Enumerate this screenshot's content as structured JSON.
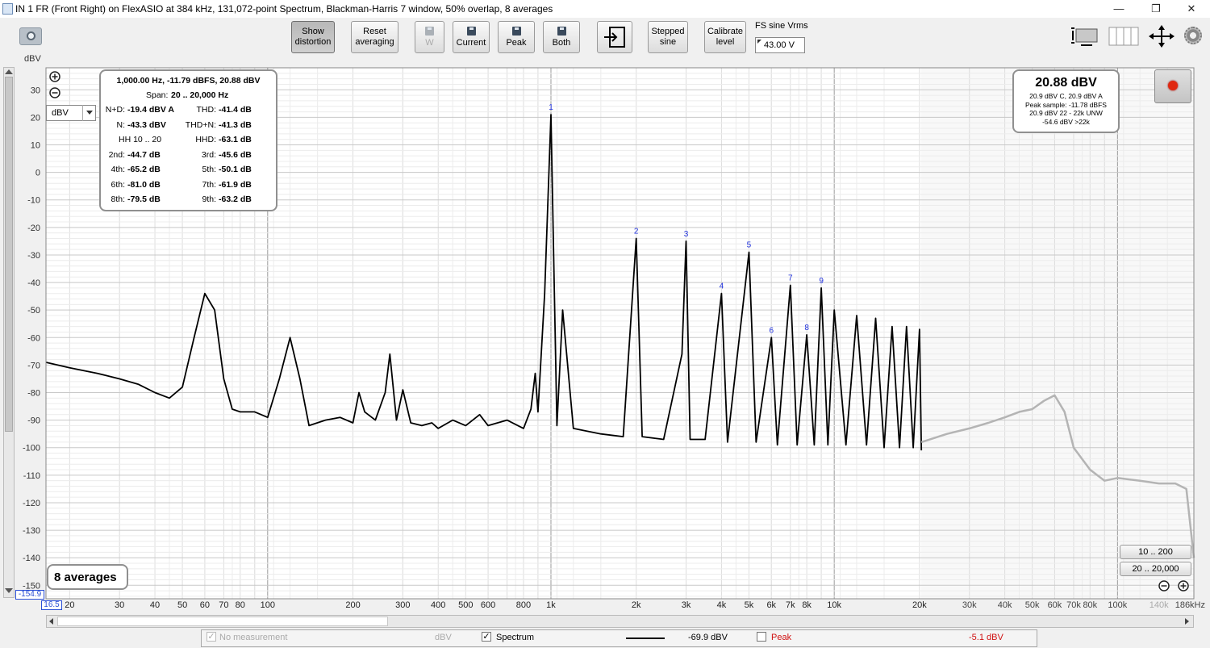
{
  "window": {
    "title": "IN 1 FR (Front Right) on FlexASIO at 384 kHz, 131,072-point Spectrum, Blackman-Harris 7 window, 50% overlap, 8 averages",
    "minimize": "—",
    "restore": "❐",
    "close": "✕"
  },
  "toolbar": {
    "show_distortion": [
      "Show",
      "distortion"
    ],
    "reset_averaging": [
      "Reset",
      "averaging"
    ],
    "w": "W",
    "current": "Current",
    "peak": "Peak",
    "both": "Both",
    "stepped_sine": [
      "Stepped",
      "sine"
    ],
    "calibrate_level": [
      "Calibrate",
      "level"
    ],
    "fs_label": "FS sine Vrms",
    "fs_value": "43.00 V"
  },
  "plot": {
    "y_unit": "dBV",
    "unit_select": "dBV",
    "y_bottom_readout": "-154.9",
    "x_left_readout": "16.5",
    "averages_label": "8 averages",
    "range_buttons": [
      "10 .. 200",
      "20 .. 20,000"
    ]
  },
  "distortion": {
    "header": "1,000.00 Hz, -11.79 dBFS, 20.88 dBV",
    "span_label": "Span:",
    "span_value": "20 .. 20,000 Hz",
    "rows": [
      {
        "l": "N+D:",
        "lv": "-19.4 dBV A",
        "r": "THD:",
        "rv": "-41.4 dB"
      },
      {
        "l": "N:",
        "lv": "-43.3 dBV",
        "r": "THD+N:",
        "rv": "-41.3 dB"
      },
      {
        "l": "HH 10 .. 20",
        "lv": "",
        "r": "HHD:",
        "rv": "-63.1 dB"
      },
      {
        "l": "2nd:",
        "lv": "-44.7 dB",
        "r": "3rd:",
        "rv": "-45.6 dB"
      },
      {
        "l": "4th:",
        "lv": "-65.2 dB",
        "r": "5th:",
        "rv": "-50.1 dB"
      },
      {
        "l": "6th:",
        "lv": "-81.0 dB",
        "r": "7th:",
        "rv": "-61.9 dB"
      },
      {
        "l": "8th:",
        "lv": "-79.5 dB",
        "r": "9th:",
        "rv": "-63.2 dB"
      }
    ]
  },
  "level": {
    "main": "20.88 dBV",
    "lines": [
      "20.9 dBV C, 20.9 dBV A",
      "Peak sample: -11.78 dBFS",
      "20.9 dBV 22 - 22k UNW",
      "-54.6 dBV >22k"
    ]
  },
  "legend": {
    "no_measurement": "No measurement",
    "no_measurement_unit": "dBV",
    "spectrum": "Spectrum",
    "spectrum_value": "-69.9 dBV",
    "peak": "Peak",
    "peak_value": "-5.1 dBV",
    "check": "✓"
  },
  "chart_data": {
    "type": "line",
    "xlabel": "",
    "ylabel": "dBV",
    "x_scale": "log",
    "xlim": [
      16.5,
      186000
    ],
    "ylim": [
      -154.9,
      38
    ],
    "x_tick_labels": [
      "20",
      "30",
      "40",
      "50",
      "60",
      "70",
      "80",
      "100",
      "200",
      "300",
      "400",
      "500",
      "600",
      "800",
      "1k",
      "2k",
      "3k",
      "4k",
      "5k",
      "6k",
      "7k",
      "8k",
      "10k",
      "20k",
      "30k",
      "40k",
      "50k",
      "60k",
      "70k",
      "80k",
      "100k",
      "140k",
      "186kHz"
    ],
    "x_tick_values": [
      20,
      30,
      40,
      50,
      60,
      70,
      80,
      100,
      200,
      300,
      400,
      500,
      600,
      800,
      1000,
      2000,
      3000,
      4000,
      5000,
      6000,
      7000,
      8000,
      10000,
      20000,
      30000,
      40000,
      50000,
      60000,
      70000,
      80000,
      100000,
      140000,
      186000
    ],
    "y_ticks": [
      30,
      20,
      10,
      0,
      -10,
      -20,
      -30,
      -40,
      -50,
      -60,
      -70,
      -80,
      -90,
      -100,
      -110,
      -120,
      -130,
      -140,
      -150
    ],
    "harmonic_markers": [
      {
        "label": "1",
        "x": 1000,
        "y": 21
      },
      {
        "label": "2",
        "x": 2000,
        "y": -24
      },
      {
        "label": "3",
        "x": 3000,
        "y": -25
      },
      {
        "label": "4",
        "x": 4000,
        "y": -44
      },
      {
        "label": "5",
        "x": 5000,
        "y": -29
      },
      {
        "label": "6",
        "x": 6000,
        "y": -60
      },
      {
        "label": "7",
        "x": 7000,
        "y": -41
      },
      {
        "label": "8",
        "x": 8000,
        "y": -59
      },
      {
        "label": "9",
        "x": 9000,
        "y": -42
      }
    ],
    "series": [
      {
        "color": "#000000",
        "points": [
          [
            16.5,
            -69
          ],
          [
            20,
            -71
          ],
          [
            25,
            -73
          ],
          [
            30,
            -75
          ],
          [
            35,
            -77
          ],
          [
            40,
            -80
          ],
          [
            45,
            -82
          ],
          [
            50,
            -78
          ],
          [
            55,
            -60
          ],
          [
            60,
            -44
          ],
          [
            65,
            -50
          ],
          [
            70,
            -75
          ],
          [
            75,
            -86
          ],
          [
            80,
            -87
          ],
          [
            90,
            -87
          ],
          [
            100,
            -89
          ],
          [
            110,
            -75
          ],
          [
            120,
            -60
          ],
          [
            130,
            -75
          ],
          [
            140,
            -92
          ],
          [
            160,
            -90
          ],
          [
            180,
            -89
          ],
          [
            200,
            -91
          ],
          [
            210,
            -80
          ],
          [
            220,
            -87
          ],
          [
            240,
            -90
          ],
          [
            260,
            -80
          ],
          [
            270,
            -66
          ],
          [
            285,
            -90
          ],
          [
            300,
            -79
          ],
          [
            320,
            -91
          ],
          [
            350,
            -92
          ],
          [
            380,
            -91
          ],
          [
            400,
            -93
          ],
          [
            450,
            -90
          ],
          [
            500,
            -92
          ],
          [
            560,
            -88
          ],
          [
            600,
            -92
          ],
          [
            700,
            -90
          ],
          [
            800,
            -93
          ],
          [
            850,
            -86
          ],
          [
            880,
            -73
          ],
          [
            900,
            -87
          ],
          [
            950,
            -44
          ],
          [
            1000,
            21
          ],
          [
            1050,
            -92
          ],
          [
            1100,
            -50
          ],
          [
            1200,
            -93
          ],
          [
            1500,
            -95
          ],
          [
            1800,
            -96
          ],
          [
            2000,
            -24
          ],
          [
            2100,
            -96
          ],
          [
            2500,
            -97
          ],
          [
            2900,
            -66
          ],
          [
            3000,
            -25
          ],
          [
            3100,
            -97
          ],
          [
            3500,
            -97
          ],
          [
            4000,
            -44
          ],
          [
            4200,
            -98
          ],
          [
            5000,
            -29
          ],
          [
            5300,
            -98
          ],
          [
            6000,
            -60
          ],
          [
            6300,
            -99
          ],
          [
            7000,
            -41
          ],
          [
            7400,
            -99
          ],
          [
            8000,
            -59
          ],
          [
            8500,
            -99
          ],
          [
            9000,
            -42
          ],
          [
            9500,
            -99
          ],
          [
            10000,
            -50
          ],
          [
            11000,
            -99
          ],
          [
            12000,
            -52
          ],
          [
            13000,
            -99
          ],
          [
            14000,
            -53
          ],
          [
            15000,
            -100
          ],
          [
            16000,
            -56
          ],
          [
            17000,
            -100
          ],
          [
            18000,
            -56
          ],
          [
            19000,
            -100
          ],
          [
            20000,
            -57
          ],
          [
            20300,
            -101
          ]
        ]
      },
      {
        "color": "#b4b4b4",
        "points": [
          [
            20300,
            -98
          ],
          [
            25000,
            -95
          ],
          [
            30000,
            -93
          ],
          [
            35000,
            -91
          ],
          [
            40000,
            -89
          ],
          [
            45000,
            -87
          ],
          [
            50000,
            -86
          ],
          [
            55000,
            -83
          ],
          [
            60000,
            -81
          ],
          [
            65000,
            -87
          ],
          [
            70000,
            -100
          ],
          [
            80000,
            -108
          ],
          [
            90000,
            -112
          ],
          [
            100000,
            -111
          ],
          [
            120000,
            -112
          ],
          [
            140000,
            -113
          ],
          [
            160000,
            -113
          ],
          [
            175000,
            -115
          ],
          [
            186000,
            -140
          ]
        ]
      }
    ]
  }
}
